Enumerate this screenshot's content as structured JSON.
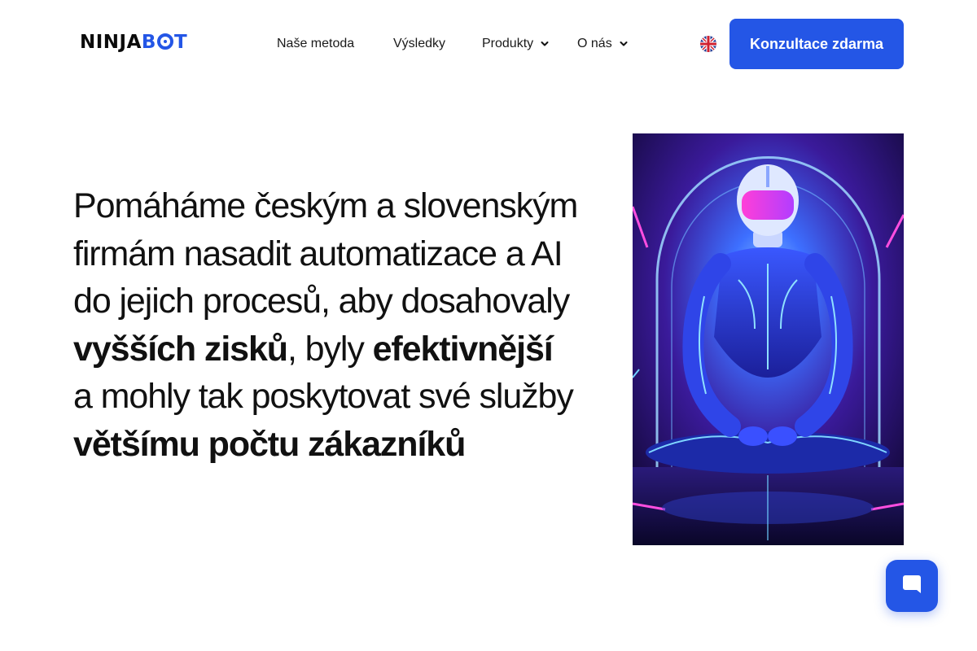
{
  "header": {
    "logo": {
      "part1": "NINJA",
      "part2_pre": "B",
      "part2_post": "T"
    },
    "nav": [
      {
        "label": "Naše metoda",
        "dropdown": false
      },
      {
        "label": "Výsledky",
        "dropdown": false
      },
      {
        "label": "Produkty",
        "dropdown": true
      },
      {
        "label": "O nás",
        "dropdown": true
      }
    ],
    "language_icon": "uk-flag-icon",
    "cta_label": "Konzultace zdarma"
  },
  "hero": {
    "line1": "Pomáháme českým a slovenským",
    "line2": "firmám nasadit automatizace a AI",
    "line3": "do jejich procesů, aby dosahovaly",
    "line4_bold": "vyšších zisků",
    "line4_rest": ", byly ",
    "line4_bold2": "efektivnější",
    "line5": "a mohly tak poskytovat své služby",
    "line6_bold": "většímu počtu zákazníků",
    "image_icon": "meditating-robot-illustration"
  },
  "chat": {
    "icon": "chat-bubble-icon"
  },
  "colors": {
    "accent": "#2456e6",
    "text": "#111111",
    "background": "#ffffff"
  }
}
